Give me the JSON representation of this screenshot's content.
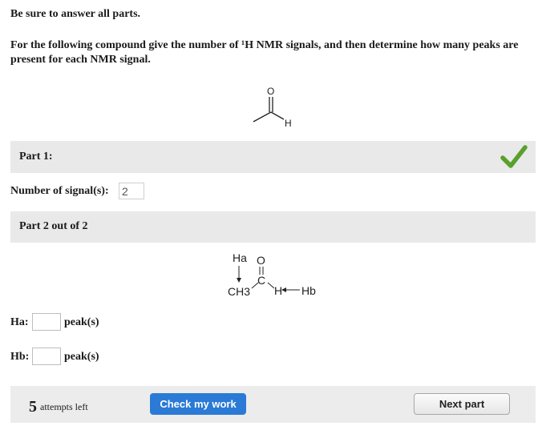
{
  "instruction": "Be sure to answer all parts.",
  "question": "For the following compound give the number of ¹H NMR signals, and then determine how many peaks are present for each NMR signal.",
  "molecule1": {
    "atom_o": "O",
    "atom_h": "H"
  },
  "part1": {
    "label": "Part 1:",
    "status_icon": "check-icon",
    "status_color": "#5aa02c"
  },
  "signals": {
    "label": "Number of signal(s):",
    "value": "2"
  },
  "part2": {
    "label": "Part 2 out of 2",
    "diagram": {
      "ha": "Ha",
      "o": "O",
      "c": "C",
      "ch3": "CH3",
      "h": "H",
      "hb": "Hb"
    },
    "rows": [
      {
        "label": "Ha:",
        "value": "",
        "suffix": "peak(s)"
      },
      {
        "label": "Hb:",
        "value": "",
        "suffix": "peak(s)"
      }
    ]
  },
  "footer": {
    "attempts_count": "5",
    "attempts_text": "attempts left",
    "check_button": "Check my work",
    "next_button": "Next part",
    "check_button_color": "#2a7ad6"
  }
}
